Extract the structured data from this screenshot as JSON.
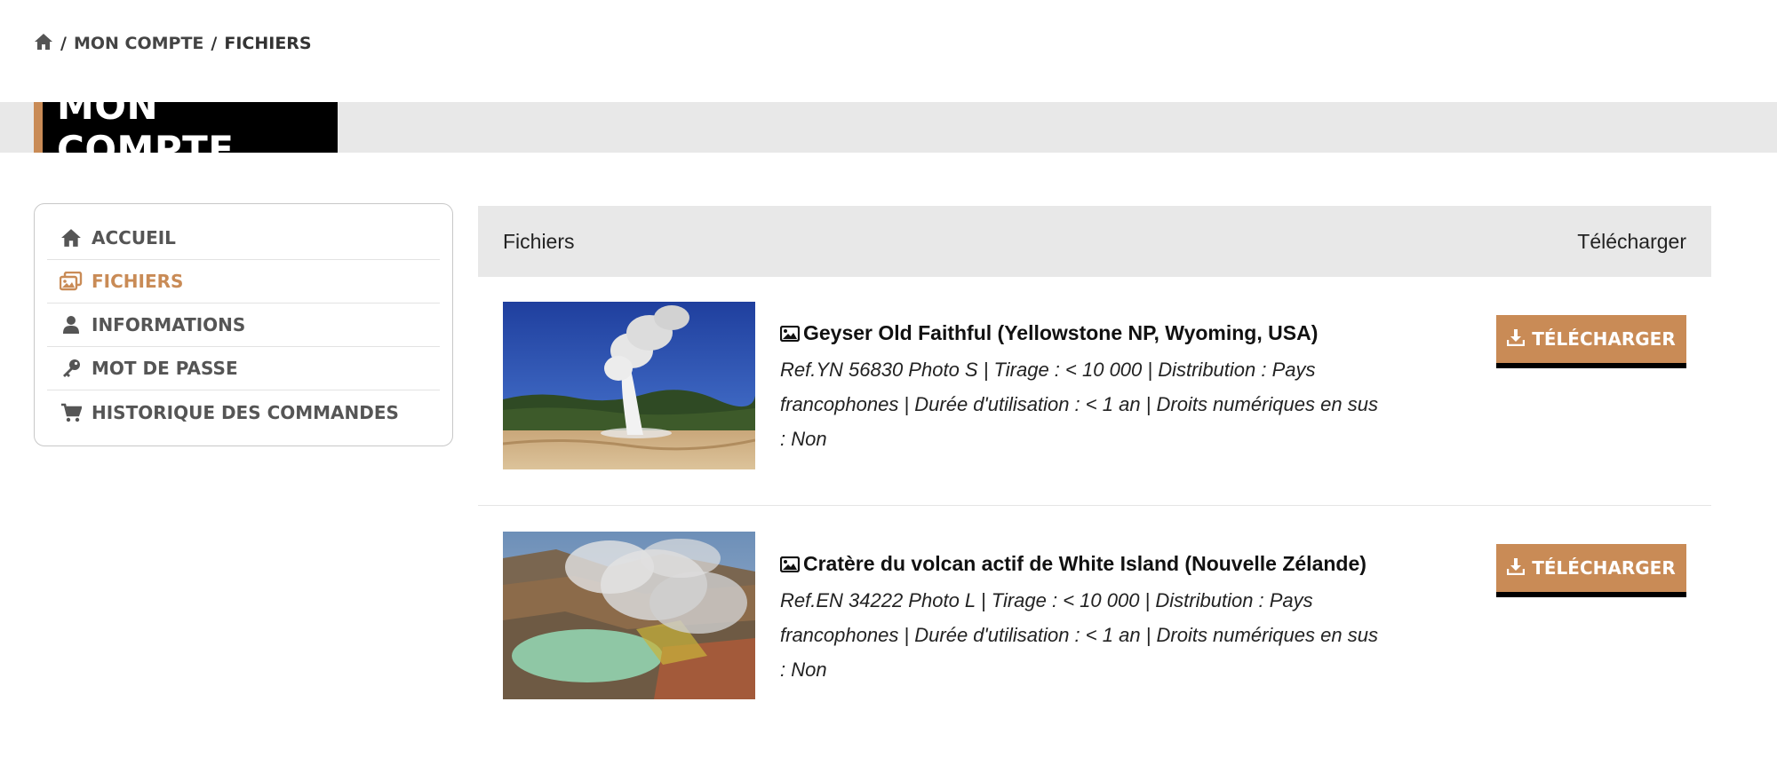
{
  "breadcrumb": {
    "icon": "home-icon",
    "separator": "/",
    "items": [
      "MON COMPTE",
      "FICHIERS"
    ]
  },
  "page_title": "MON COMPTE",
  "sidebar": {
    "items": [
      {
        "label": "ACCUEIL",
        "icon": "home-icon",
        "active": false
      },
      {
        "label": "FICHIERS",
        "icon": "images-icon",
        "active": true
      },
      {
        "label": "INFORMATIONS",
        "icon": "user-icon",
        "active": false
      },
      {
        "label": "MOT DE PASSE",
        "icon": "key-icon",
        "active": false
      },
      {
        "label": "HISTORIQUE DES COMMANDES",
        "icon": "cart-icon",
        "active": false
      }
    ]
  },
  "table": {
    "col_files": "Fichiers",
    "col_download": "Télécharger",
    "rows": [
      {
        "title": "Geyser Old Faithful (Yellowstone NP, Wyoming, USA)",
        "details": "Ref.YN 56830 Photo S | Tirage : < 10 000 | Distribution : Pays francophones | Durée d'utilisation : < 1 an | Droits numériques en sus : Non",
        "button": "TÉLÉCHARGER"
      },
      {
        "title": "Cratère du volcan actif de White Island (Nouvelle Zélande)",
        "details": "Ref.EN 34222 Photo L | Tirage : < 10 000 | Distribution : Pays francophones | Durée d'utilisation : < 1 an | Droits numériques en sus : Non",
        "button": "TÉLÉCHARGER"
      }
    ]
  },
  "colors": {
    "accent": "#c98b56",
    "band": "#e8e8e8",
    "title_bg": "#000000"
  }
}
